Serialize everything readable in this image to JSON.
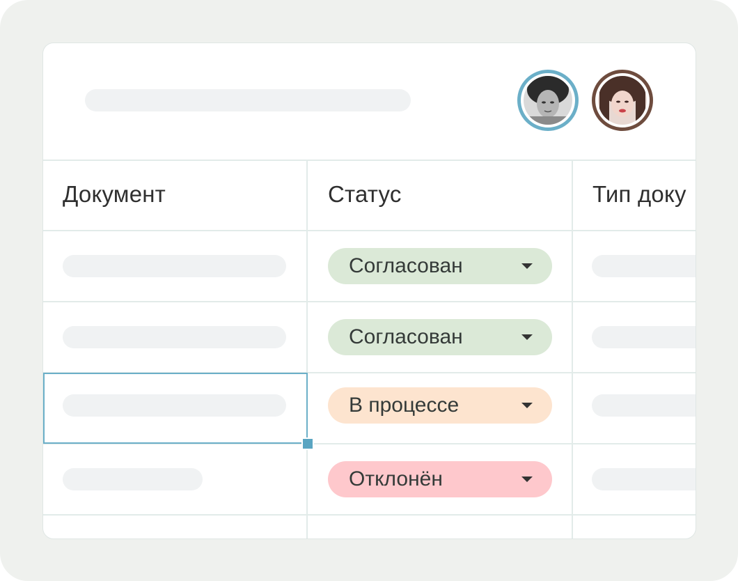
{
  "table": {
    "columns": [
      {
        "label": "Документ"
      },
      {
        "label": "Статус"
      },
      {
        "label": "Тип доку"
      }
    ],
    "rows": [
      {
        "status": "Согласован"
      },
      {
        "status": "Согласован"
      },
      {
        "status": "В процессе"
      },
      {
        "status": "Отклонён"
      }
    ]
  },
  "status_colors": {
    "approved": "#dbe9d7",
    "in_progress": "#fde4cf",
    "rejected": "#fec8cc"
  },
  "accent": "#6bafc8",
  "icons": [
    "caret-down-icon"
  ]
}
